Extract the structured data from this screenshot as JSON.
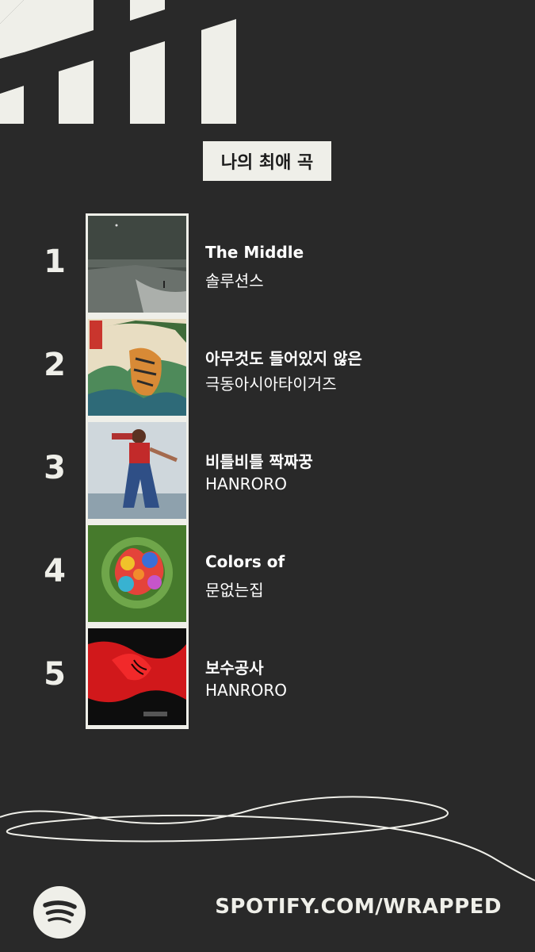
{
  "header": {
    "title": "나의 최애 곡"
  },
  "tracks": [
    {
      "rank": "1",
      "title": "The Middle",
      "artist": "솔루션스"
    },
    {
      "rank": "2",
      "title": "아무것도 들어있지 않은",
      "artist": "극동아시아타이거즈"
    },
    {
      "rank": "3",
      "title": "비틀비틀 짝짜꿍",
      "artist": "HANRORO"
    },
    {
      "rank": "4",
      "title": "Colors of",
      "artist": "문없는집"
    },
    {
      "rank": "5",
      "title": "보수공사",
      "artist": "HANRORO"
    }
  ],
  "footer": {
    "url": "SPOTIFY.COM/WRAPPED",
    "logo": "spotify-icon"
  },
  "colors": {
    "background": "#292929",
    "accent": "#efefe9"
  }
}
